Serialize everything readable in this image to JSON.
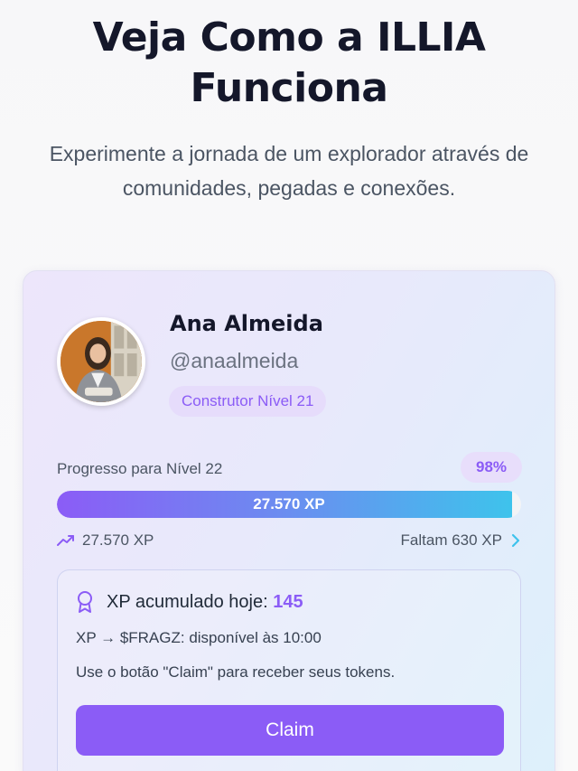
{
  "hero": {
    "title": "Veja Como a ILLIA Funciona",
    "subtitle": "Experimente a jornada de um explorador através de comunidades, pegadas e conexões."
  },
  "profile": {
    "name": "Ana Almeida",
    "handle": "@anaalmeida",
    "level_badge": "Construtor Nível 21",
    "avatar_icon": "avatar-photo"
  },
  "progress": {
    "label": "Progresso para Nível 22",
    "percent_text": "98%",
    "fill_fraction": 0.98,
    "bar_text": "27.570 XP",
    "current_xp": "27.570 XP",
    "remaining": "Faltam 630 XP",
    "trend_icon": "trending-up-icon",
    "chevron_icon": "chevron-right-icon"
  },
  "xp_panel": {
    "today_label": "XP acumulado hoje:",
    "today_value": "145",
    "convert_text": "XP → $FRAGZ: disponível às 10:00",
    "hint": "Use o botão \"Claim\" para receber seus tokens.",
    "claim_label": "Claim",
    "award_icon": "award-icon"
  },
  "colors": {
    "accent": "#8b5cf6",
    "cyan": "#3ec3ec",
    "text_dark": "#14172a"
  }
}
